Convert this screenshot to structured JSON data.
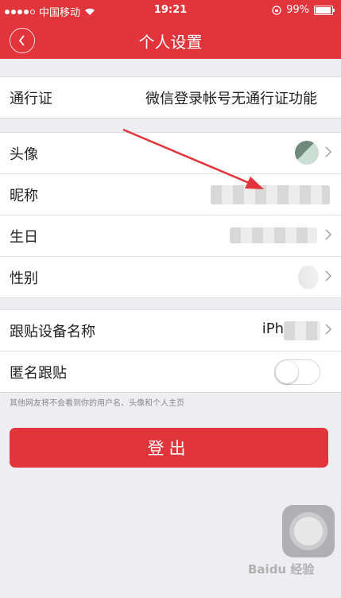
{
  "status_bar": {
    "carrier": "中国移动",
    "time": "19:21",
    "battery": "99%",
    "signal_icon": "signal-dots-icon",
    "wifi_icon": "wifi-icon",
    "lock_icon": "rotation-lock-icon"
  },
  "nav": {
    "title": "个人设置",
    "back_icon": "chevron-left-icon"
  },
  "passport": {
    "label": "通行证",
    "value": "微信登录帐号无通行证功能"
  },
  "profile": {
    "avatar_label": "头像",
    "nickname_label": "昵称",
    "birthday_label": "生日",
    "gender_label": "性别"
  },
  "device": {
    "device_name_label": "跟贴设备名称",
    "device_name_value": "iPh",
    "anonymous_label": "匿名跟贴",
    "anonymous_on": false
  },
  "hint": "其他网友将不会看到你的用户名、头像和个人主页",
  "logout_label": "登出",
  "watermark": "Baidu 经验",
  "colors": {
    "accent": "#e2343b",
    "background": "#eeeef2"
  }
}
